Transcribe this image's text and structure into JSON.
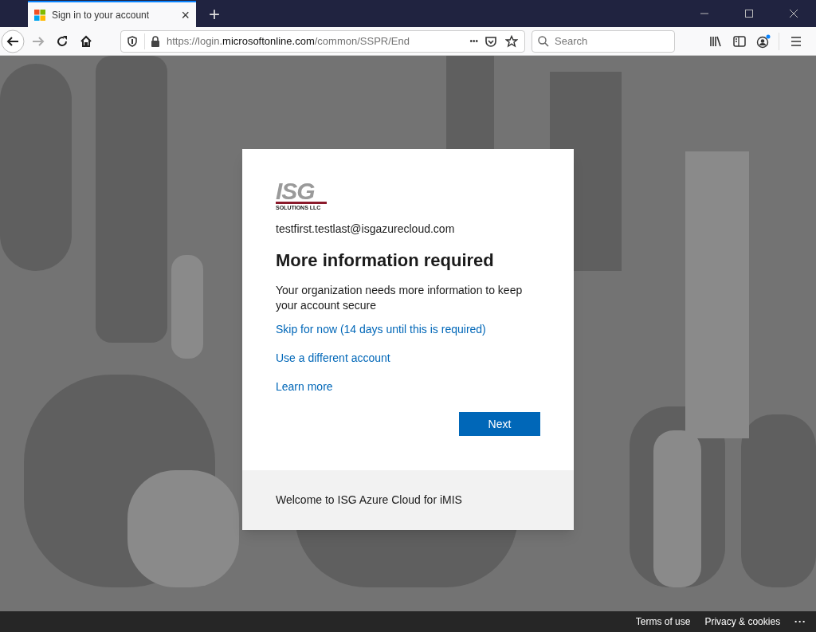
{
  "browser": {
    "tab": {
      "title": "Sign in to your account",
      "close": "×",
      "selected": true
    },
    "new_tab": "+",
    "url": {
      "prefix": "https://login.",
      "host": "microsoftonline.com",
      "path": "/common/SSPR/End"
    },
    "page_actions": "•••",
    "search": {
      "placeholder": "Search"
    }
  },
  "card": {
    "logo": {
      "mark": "ISG",
      "subtitle": "SOLUTIONS LLC"
    },
    "account": "testfirst.testlast@isgazurecloud.com",
    "title": "More information required",
    "description": "Your organization needs more information to keep your account secure",
    "links": [
      "Skip for now (14 days until this is required)",
      "Use a different account",
      "Learn more"
    ],
    "button": "Next",
    "footer": "Welcome to ISG Azure Cloud for iMIS"
  },
  "page_footer": {
    "links": [
      "Terms of use",
      "Privacy & cookies"
    ],
    "more": "• • •"
  }
}
